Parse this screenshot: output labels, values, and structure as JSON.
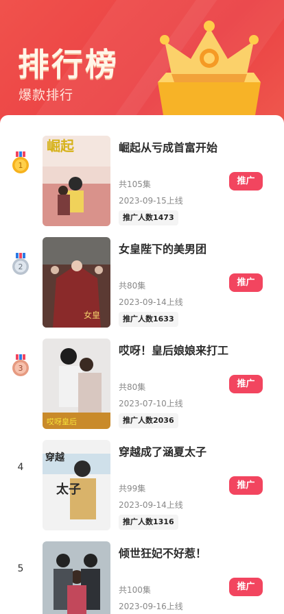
{
  "header": {
    "title": "排行榜",
    "subtitle": "爆款排行"
  },
  "colors": {
    "accent": "#f2455f",
    "hero_bg": "#ea3f43",
    "gold": "#f6b21e",
    "silver": "#b9c3cf",
    "bronze": "#e69a80"
  },
  "list": [
    {
      "rank": "1",
      "medal": "gold-medal-icon",
      "title": "崛起从亏成首富开始",
      "episodes": "共105集",
      "date": "2023-09-15上线",
      "count": "推广人数1473",
      "button": "推广"
    },
    {
      "rank": "2",
      "medal": "silver-medal-icon",
      "title": "女皇陛下的美男团",
      "episodes": "共80集",
      "date": "2023-09-14上线",
      "count": "推广人数1633",
      "button": "推广"
    },
    {
      "rank": "3",
      "medal": "bronze-medal-icon",
      "title": "哎呀！皇后娘娘来打工",
      "episodes": "共80集",
      "date": "2023-07-10上线",
      "count": "推广人数2036",
      "button": "推广"
    },
    {
      "rank": "4",
      "medal": "",
      "title": "穿越成了涵夏太子",
      "episodes": "共99集",
      "date": "2023-09-14上线",
      "count": "推广人数1316",
      "button": "推广"
    },
    {
      "rank": "5",
      "medal": "",
      "title": "倾世狂妃不好惹！",
      "episodes": "共100集",
      "date": "2023-09-16上线",
      "count": "",
      "button": "推广"
    }
  ]
}
